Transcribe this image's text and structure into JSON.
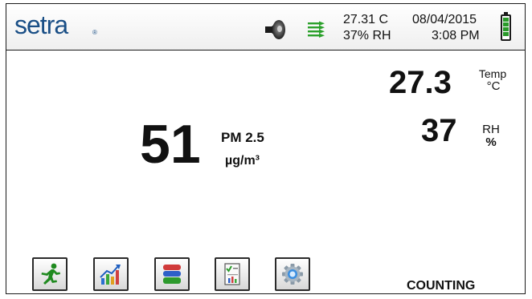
{
  "header": {
    "logo_text": "setra",
    "logo_reg": "®",
    "temperature": "27.31 C",
    "humidity": "37% RH",
    "date": "08/04/2015",
    "time": "3:08 PM",
    "icons": [
      "speaker-icon",
      "connection-arrows-icon",
      "battery-icon"
    ]
  },
  "main": {
    "pm_value": "51",
    "pm_label": "PM 2.5",
    "pm_unit": "µg/m³",
    "temp_value": "27.3",
    "temp_label": "Temp",
    "temp_unit": "°C",
    "rh_value": "37",
    "rh_label": "RH",
    "rh_unit": "%"
  },
  "toolbar": {
    "buttons": [
      "run-icon",
      "chart-icon",
      "database-icon",
      "report-icon",
      "settings-icon"
    ]
  },
  "status": {
    "text": "COUNTING"
  },
  "colors": {
    "logo": "#1a4f86",
    "battery_fill": "#2a9a2a",
    "arrow_green": "#2aa02a"
  }
}
